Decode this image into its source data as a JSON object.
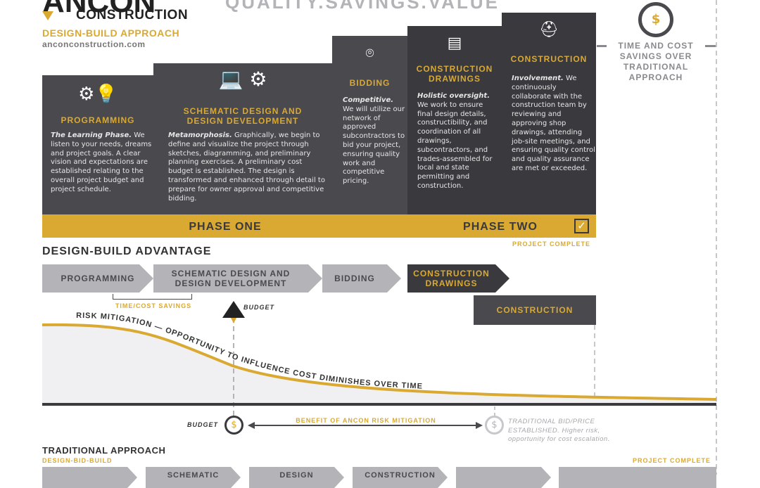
{
  "header": {
    "logo_top": "ANCON",
    "logo_sub": "CONSTRUCTION",
    "approach": "DESIGN-BUILD APPROACH",
    "website": "anconconstruction.com",
    "tagline": "QUALITY.SAVINGS.VALUE"
  },
  "steps": [
    {
      "title": "PROGRAMMING",
      "lead": "The Learning Phase.",
      "body": " We listen to your needs, dreams and project goals. A clear vision and expectations are established relating to the overall project budget and project schedule.",
      "icon": "gears-lightbulb-icon"
    },
    {
      "title": "SCHEMATIC DESIGN AND DESIGN DEVELOPMENT",
      "lead": "Metamorphosis.",
      "body": " Graphically, we begin to define and visualize the project through sketches, diagramming, and preliminary planning exercises. A preliminary cost budget is established. The design is transformed and enhanced through detail to prepare for owner approval and competitive bidding.",
      "icon": "laptop-gears-icon"
    },
    {
      "title": "BIDDING",
      "lead": "Competitive.",
      "body": " We will utilize our network of approved subcontractors to bid your project, ensuring quality work and competitive pricing.",
      "icon": "magnifier-check-icon"
    },
    {
      "title": "CONSTRUCTION DRAWINGS",
      "lead": "Holistic oversight.",
      "body": " We work to ensure final design details, constructibility, and coordination of all drawings, subcontractors, and trades-assembled for local and state permitting and construction.",
      "icon": "blueprint-icon"
    },
    {
      "title": "CONSTRUCTION",
      "lead": "Involvement.",
      "body": " We continuously collaborate with the construction team by reviewing and approving shop drawings, attending job-site meetings, and ensuring quality control and quality assurance are met or exceeded.",
      "icon": "hardhat-icon"
    }
  ],
  "phases": {
    "one": "PHASE ONE",
    "two": "PHASE TWO",
    "complete": "PROJECT COMPLETE"
  },
  "savings": {
    "label": "TIME AND COST SAVINGS OVER TRADITIONAL APPROACH",
    "icon": "cycle-dollar-icon"
  },
  "advantage": {
    "title": "DESIGN-BUILD ADVANTAGE",
    "arrows": [
      "PROGRAMMING",
      "SCHEMATIC DESIGN AND DESIGN DEVELOPMENT",
      "BIDDING",
      "CONSTRUCTION DRAWINGS"
    ],
    "construction": "CONSTRUCTION",
    "time_cost": "TIME/COST SAVINGS",
    "budget": "BUDGET",
    "curve_label": "RISK MITIGATION  —  OPPORTUNITY TO INFLUENCE COST DIMINISHES OVER TIME"
  },
  "benefit": {
    "budget": "BUDGET",
    "label": "BENEFIT OF ANCON RISK MITIGATION",
    "traditional_note_1": "TRADITIONAL BID/PRICE",
    "traditional_note_2": "ESTABLISHED. Higher risk,",
    "traditional_note_3": "opportunity for cost escalation.",
    "dollar": "$"
  },
  "traditional": {
    "title": "TRADITIONAL APPROACH",
    "subtitle": "DESIGN-BID-BUILD",
    "complete": "PROJECT COMPLETE",
    "boxes": [
      "",
      "SCHEMATIC",
      "DESIGN",
      "CONSTRUCTION",
      "",
      ""
    ]
  },
  "colors": {
    "gold": "#d9a932",
    "dark": "#4a494e",
    "darker": "#3a393d",
    "gray": "#b4b4b8"
  }
}
